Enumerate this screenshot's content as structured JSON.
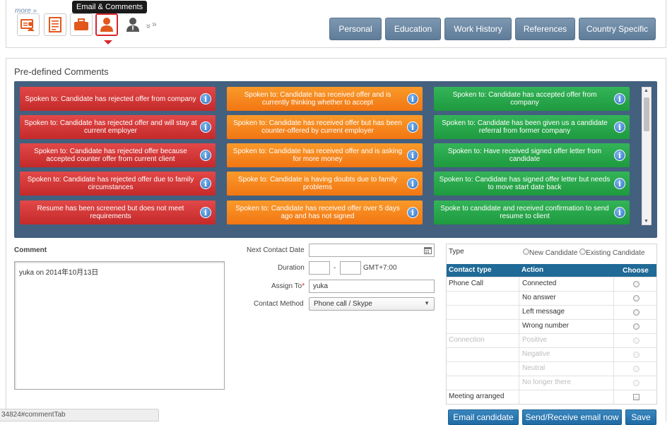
{
  "top": {
    "more_link": "more »",
    "tooltip": "Email & Comments",
    "icons": [
      "business-card-icon",
      "resume-icon",
      "briefcase-icon",
      "email-comments-person-icon",
      "person-icon"
    ],
    "tabs": [
      "Personal",
      "Education",
      "Work History",
      "References",
      "Country Specific"
    ]
  },
  "predefined": {
    "title": "Pre-defined Comments",
    "columns": [
      {
        "color": "red",
        "items": [
          "Spoken to: Candidate has rejected offer from company",
          "Spoken to: Candidate has rejected offer and will stay at current employer",
          "Spoken to: Candidate has rejected offer because accepted counter offer from current client",
          "Spoken to: Candidate has rejected offer due to family circumstances",
          "Resume has been screened but does not meet requirements"
        ]
      },
      {
        "color": "orange",
        "items": [
          "Spoken to: Candidate has received offer and is currently thinking whether to accept",
          "Spoken to: Candidate has received offer but has been counter-offered by current employer",
          "Spoken to: Candidate has received offer and is asking for more money",
          "Spoke to: Candidate is having doubts due to family problems",
          "Spoken to: Candidate has received offer over 5 days ago and has not signed"
        ]
      },
      {
        "color": "green",
        "items": [
          "Spoken to: Candidate has accepted offer from company",
          "Spoken to: Candidate has been given us a candidate referral from former company",
          "Spoken to: Have received signed offer letter from candidate",
          "Spoken to: Candidate has signed offer letter but needs to move start date back",
          "Spoke to candidate and received confirmation to send resume to client"
        ]
      }
    ]
  },
  "form": {
    "comment_label": "Comment",
    "comment_value": "yuka on 2014年10月13日",
    "next_contact_label": "Next Contact Date",
    "next_contact_value": "",
    "duration_label": "Duration",
    "timezone": "GMT+7:00",
    "duration_sep": "-",
    "assign_label": "Assign To",
    "assign_required": "*",
    "assign_value": "yuka",
    "method_label": "Contact Method",
    "method_value": "Phone call / Skype"
  },
  "contact": {
    "type_label": "Type",
    "type_options": [
      "New Candidate",
      "Existing Candidate"
    ],
    "headers": [
      "Contact type",
      "Action",
      "Choose"
    ],
    "phone_call": "Phone Call",
    "phone_actions": [
      "Connected",
      "No answer",
      "Left message",
      "Wrong number"
    ],
    "connection": "Connection",
    "connection_actions": [
      "Positive",
      "Negative",
      "Neutral",
      "No longer there"
    ],
    "meeting": "Meeting arranged"
  },
  "buttons": {
    "email": "Email candidate",
    "send_receive": "Send/Receive email now",
    "save": "Save"
  },
  "status_url": "34824#commentTab"
}
